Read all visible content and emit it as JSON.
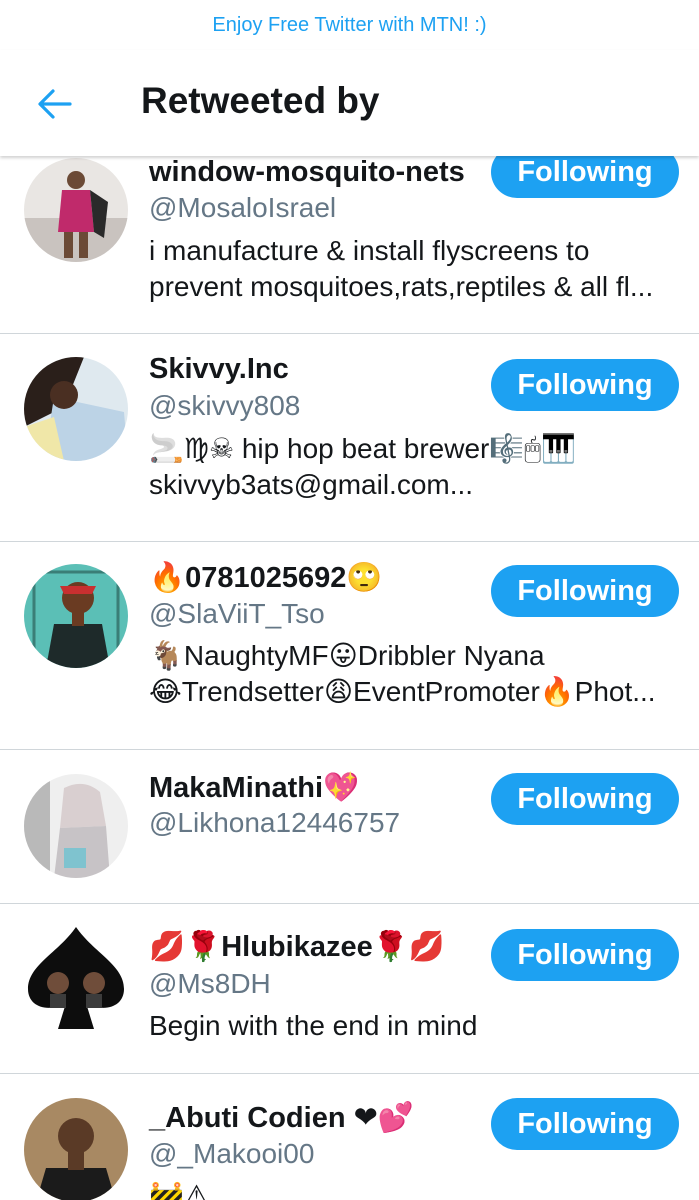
{
  "promo_text": "Enjoy Free Twitter with MTN! :)",
  "header": {
    "title": "Retweeted by",
    "back_icon": "arrow-left-icon"
  },
  "accent_color": "#1da1f2",
  "users": [
    {
      "name": "window-mosquito-nets",
      "handle": "@MosaloIsrael",
      "bio": [
        "i manufacture & install flyscreens to",
        "prevent mosquitoes,rats,reptiles & all fl..."
      ],
      "button": "Following"
    },
    {
      "name": "Skivvy.Inc",
      "handle": "@skivvy808",
      "bio": [
        "🚬♍☠ hip hop beat brewer🎼🖱🎹",
        "skivvyb3ats@gmail.com..."
      ],
      "button": "Following"
    },
    {
      "name": "🔥0781025692🙄",
      "handle": "@SlaViiT_Tso",
      "bio": [
        "🐐NaughtyMF😛Dribbler Nyana",
        "😂Trendsetter😩EventPromoter🔥Phot..."
      ],
      "button": "Following"
    },
    {
      "name": "MakaMinathi💖",
      "handle": "@Likhona12446757",
      "bio": [],
      "button": "Following"
    },
    {
      "name": "💋🌹Hlubikazee🌹💋",
      "handle": "@Ms8DH",
      "bio": [
        "Begin with the end in mind"
      ],
      "button": "Following"
    },
    {
      "name": "_Abuti Codien ❤💕",
      "handle": "@_Makooi00",
      "bio": [
        "🚧⚠"
      ],
      "button": "Following"
    }
  ]
}
